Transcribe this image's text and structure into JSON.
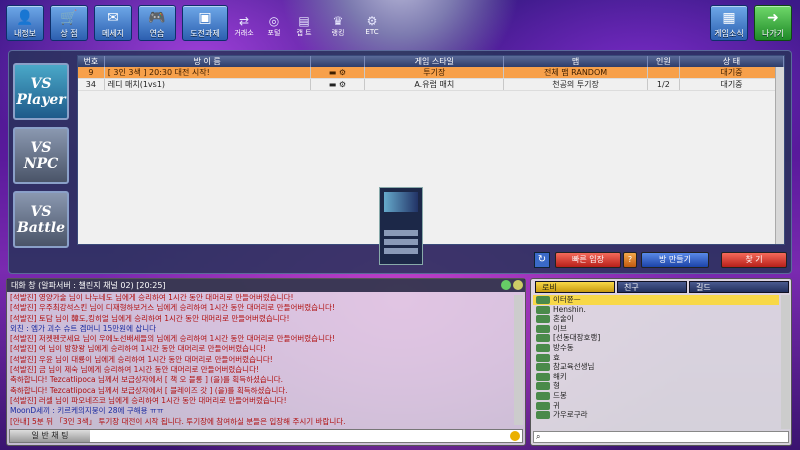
{
  "nav": {
    "my_info": "내정보",
    "shop": "상 점",
    "message": "메세지",
    "practice": "연습",
    "challenge": "도전과제",
    "news": "게임소식",
    "exit": "나가기"
  },
  "mini": [
    "거래소",
    "포털",
    "캡 트",
    "랭킹",
    "ETC"
  ],
  "modes": [
    "VS Player",
    "VS NPC",
    "VS Battle"
  ],
  "table": {
    "headers": [
      "번호",
      "방 이 름",
      "",
      "게임 스타일",
      "맵",
      "인원",
      "상 태"
    ],
    "rows": [
      {
        "no": "9",
        "name": "[ 3인 3색 ] 20:30 대전 시작!",
        "style": "투기장",
        "map": "전체 맵 RANDOM",
        "players": "",
        "status": "대기중"
      },
      {
        "no": "34",
        "name": "레디 매치(1vs1)",
        "style": "A.유럽 매치",
        "map": "천공의 투기장",
        "players": "1/2",
        "status": "대기중"
      }
    ]
  },
  "buttons": {
    "quick_join": "빠른 입장",
    "create_room": "방 만들기",
    "find": "찾 기"
  },
  "chat": {
    "title": "대화 창 (알파서버 : 챌린지 채널 02) [20:25]",
    "lines": [
      {
        "t": "[석발진] 영양가술 님이 나누네도 님에게 승리하여 1시간 동안 대머리로 만들어버렸습니다!",
        "c": "red"
      },
      {
        "t": "[석발진] 우주최강석스킨 님이 디재형하보거스 님에게 승리하여 1시간 동안 대머리로 만들어버렸습니다!",
        "c": "red"
      },
      {
        "t": "[석발진] 토담 님이 韓도,킹히얼 님에게 승리하여 1시간 동안 대머리로 만들어버렸습니다!",
        "c": "red"
      },
      {
        "t": "외친 : 엠가 괴수 슈트 겜머니 15만원에 삽니다",
        "c": "blue"
      },
      {
        "t": "[석발진] 저켓펜굿세요 님이 우에노선배세들의 님에게 승리하여 1시간 동안 대머리로 만들어버렸습니다!",
        "c": "red"
      },
      {
        "t": "[석발진] 여 님이 방향왕 님에게 승리하여 1시간 동안 대머리로 만들어버렸습니다!",
        "c": "red"
      },
      {
        "t": "[석발진] 우윤 님이 대룡이 님에게 승리하여 1시간 동안 대머리로 만들어버렸습니다!",
        "c": "red"
      },
      {
        "t": "[석발진] 금 님이 제숙 님에게 승리하여 1시간 동안 대머리로 만들어버렸습니다!",
        "c": "red"
      },
      {
        "t": "축하합니다! Tezcatlipoca 님께서 보급상자에서 [ 책 오 블롱 ] (을)를 획득하셨습니다.",
        "c": "red"
      },
      {
        "t": "축하합니다! Tezcatlipoca 님께서 보급상자에서 [ 블레이즈 갓 ] (을)를 획득하셨습니다.",
        "c": "red"
      },
      {
        "t": "[석발진] 러셀 님이 파오네즈코 님에게 승리하여 1시간 동안 대머리로 만들어버렸습니다!",
        "c": "red"
      },
      {
        "t": "MoonD세끼 : 키르케의지뭉이 28에 구해용 ㅠㅠ",
        "c": "blue"
      },
      {
        "t": "[안내] 5분 뒤 「3인 3색」 투기장 대전이 시작 됩니다. 투기장에 참여하실 분들은 입장해 주시기 바랍니다.",
        "c": "red"
      }
    ],
    "input_mode": "일 반 채 팅"
  },
  "friends": {
    "tabs": [
      "로비",
      "친구",
      "길드"
    ],
    "items": [
      "이터쮼ㅡ",
      "Henshin.",
      "혼술이",
      "이브",
      "[선동대장호랭]",
      "방수동",
      "효",
      "참교육선생님",
      "해키",
      "형",
      "드봉",
      "귀",
      "가우로구라"
    ]
  }
}
